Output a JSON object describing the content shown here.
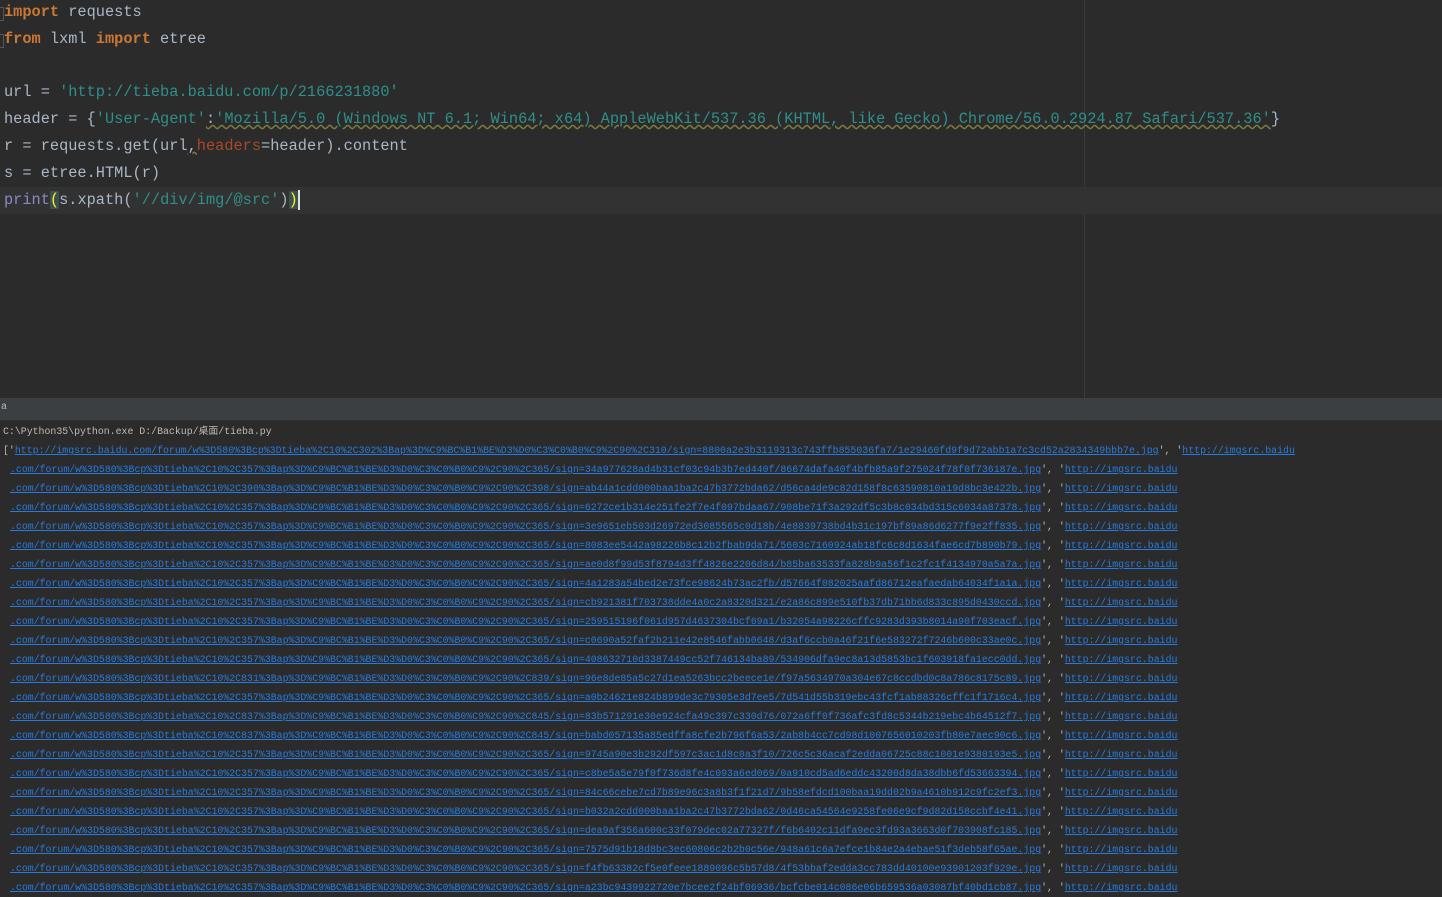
{
  "editor": {
    "lines": {
      "l1_kw": "import",
      "l1_rest": " requests",
      "l2_kw1": "from",
      "l2_mid": " lxml ",
      "l2_kw2": "import",
      "l2_rest": " etree",
      "l4_a": "url = ",
      "l4_str": "'http://tieba.baidu.com/p/2166231880'",
      "l5_a": "header = {",
      "l5_key": "'User-Agent'",
      "l5_colon": ":",
      "l5_val": "'Mozilla/5.0 (Windows NT 6.1; Win64; x64) AppleWebKit/537.36 (KHTML, like Gecko) Chrome/56.0.2924.87 Safari/537.36'",
      "l5_end": "}",
      "l6_a": "r = requests.get(url",
      "l6_comma": ",",
      "l6_param": "headers",
      "l6_rest": "=header).content",
      "l7": "s = etree.HTML(r)",
      "l8_fn": "print",
      "l8_open": "(",
      "l8_mid": "s.xpath(",
      "l8_str": "'//div/img/@src'",
      "l8_close1": ")",
      "l8_close2": ")"
    }
  },
  "run_panel": {
    "tab_label": "a",
    "command": "C:\\Python35\\python.exe D:/Backup/桌面/tieba.py",
    "first_line": {
      "prefix": "['",
      "link": "http://imgsrc.baidu.com/forum/w%3D580%3Bcp%3Dtieba%2C10%2C302%3Bap%3D%C9%BC%B1%BE%D3%D0%C3%C0%B0%C9%2C90%2C310/sign=8800a2e3b3119313c743ffb855036fa7/1e29460fd9f9d72abb1a7c3cd52a2834349bbb7e.jpg",
      "sep": "', '",
      "next": "http://imgsrc.baidu"
    },
    "rows": [
      ".com/forum/w%3D580%3Bcp%3Dtieba%2C10%2C357%3Bap%3D%C9%BC%B1%BE%D3%D0%C3%C0%B0%C9%2C90%2C365/sign=34a977628ad4b31cf03c94b3b7ed440f/86674dafa40f4bfb85a9f275024f78f0f736187e.jpg",
      ".com/forum/w%3D580%3Bcp%3Dtieba%2C10%2C390%3Bap%3D%C9%BC%B1%BE%D3%D0%C3%C0%B0%C9%2C90%2C398/sign=ab44a1cdd000baa1ba2c47b3772bda62/d56ca4de9c82d158f8c63590810a19d8bc3e422b.jpg",
      ".com/forum/w%3D580%3Bcp%3Dtieba%2C10%2C357%3Bap%3D%C9%BC%B1%BE%D3%D0%C3%C0%B0%C9%2C90%2C365/sign=6272ce1b314e251fe2f7e4f097bdaa67/908be71f3a292df5c3b8c034bd315c6034a87378.jpg",
      ".com/forum/w%3D580%3Bcp%3Dtieba%2C10%2C357%3Bap%3D%C9%BC%B1%BE%D3%D0%C3%C0%B0%C9%2C90%2C365/sign=3e9651eb503d26972ed3085565c0d18b/4e8839738bd4b31c197bf89a86d6277f9e2ff835.jpg",
      ".com/forum/w%3D580%3Bcp%3Dtieba%2C10%2C357%3Bap%3D%C9%BC%B1%BE%D3%D0%C3%C0%B0%C9%2C90%2C365/sign=8083ee5442a98226b8c12b2fbab9da71/5603c7160924ab18fc6c8d1634fae6cd7b890b79.jpg",
      ".com/forum/w%3D580%3Bcp%3Dtieba%2C10%2C357%3Bap%3D%C9%BC%B1%BE%D3%D0%C3%C0%B0%C9%2C90%2C365/sign=ae0d8f99d53f8794d3ff4826e2206d84/b85ba63533fa828b9a56f1c2fc1f4134970a5a7a.jpg",
      ".com/forum/w%3D580%3Bcp%3Dtieba%2C10%2C357%3Bap%3D%C9%BC%B1%BE%D3%D0%C3%C0%B0%C9%2C90%2C365/sign=4a1283a54bed2e73fce98624b73ac2fb/d57664f082025aafd86712eafaedab64034f1a1a.jpg",
      ".com/forum/w%3D580%3Bcp%3Dtieba%2C10%2C357%3Bap%3D%C9%BC%B1%BE%D3%D0%C3%C0%B0%C9%2C90%2C365/sign=cb921381f703738dde4a0c2a8320d321/e2a86c899e510fb37db71bb6d833c895d0430ccd.jpg",
      ".com/forum/w%3D580%3Bcp%3Dtieba%2C10%2C357%3Bap%3D%C9%BC%B1%BE%D3%D0%C3%C0%B0%C9%2C90%2C365/sign=259515196f061d957d4637304bcf69a1/b32054a98226cffc9283d393b8014a90f703eacf.jpg",
      ".com/forum/w%3D580%3Bcp%3Dtieba%2C10%2C357%3Bap%3D%C9%BC%B1%BE%D3%D0%C3%C0%B0%C9%2C90%2C365/sign=c0690a52faf2b211e42e8546fabb0648/d3af6ccb0a46f21f6e583272f7246b600c33ae0c.jpg",
      ".com/forum/w%3D580%3Bcp%3Dtieba%2C10%2C357%3Bap%3D%C9%BC%B1%BE%D3%D0%C3%C0%B0%C9%2C90%2C365/sign=408632710d3387449cc52f746134ba89/534906dfa9ec8a13d5853bc1f603918fa1ecc0dd.jpg",
      ".com/forum/w%3D580%3Bcp%3Dtieba%2C10%2C831%3Bap%3D%C9%BC%B1%BE%D3%D0%C3%C0%B0%C9%2C90%2C839/sign=96e8de85a5c27d1ea5263bcc2beece1e/f97a5634970a304e67c8ccdbd0c8a786c8175c89.jpg",
      ".com/forum/w%3D580%3Bcp%3Dtieba%2C10%2C357%3Bap%3D%C9%BC%B1%BE%D3%D0%C3%C0%B0%C9%2C90%2C365/sign=a0b24621e824b899de3c79305e3d7ee5/7d541d55b319ebc43fcf1ab88326cffc1f1716c4.jpg",
      ".com/forum/w%3D580%3Bcp%3Dtieba%2C10%2C837%3Bap%3D%C9%BC%B1%BE%D3%D0%C3%C0%B0%C9%2C90%2C845/sign=83b571291e30e924cfa49c397c330d76/072a6ff0f736afc3fd8c5344b219ebc4b64512f7.jpg",
      ".com/forum/w%3D580%3Bcp%3Dtieba%2C10%2C837%3Bap%3D%C9%BC%B1%BE%D3%D0%C3%C0%B0%C9%2C90%2C845/sign=babd057135a85edffa8cfe2b796f6a53/2ab8b4cc7cd98d1007656010203fb80e7aec90c6.jpg",
      ".com/forum/w%3D580%3Bcp%3Dtieba%2C10%2C357%3Bap%3D%C9%BC%B1%BE%D3%D0%C3%C0%B0%C9%2C90%2C365/sign=9745a90e3b292df597c3ac1d8c0a3f10/726c5c36acaf2edda06725c88c1001e9380193e5.jpg",
      ".com/forum/w%3D580%3Bcp%3Dtieba%2C10%2C357%3Bap%3D%C9%BC%B1%BE%D3%D0%C3%C0%B0%C9%2C90%2C365/sign=c8be5a5e79f0f736d8fe4c093a6ed069/0a910cd5ad6eddc43200d8da38dbb6fd53663394.jpg",
      ".com/forum/w%3D580%3Bcp%3Dtieba%2C10%2C357%3Bap%3D%C9%BC%B1%BE%D3%D0%C3%C0%B0%C9%2C90%2C365/sign=84c66cebe7cd7b89e96c3a8b3f1f21d7/9b58efdcd100baa19dd02b9a4610b912c9fc2ef3.jpg",
      ".com/forum/w%3D580%3Bcp%3Dtieba%2C10%2C357%3Bap%3D%C9%BC%B1%BE%D3%D0%C3%C0%B0%C9%2C90%2C365/sign=b032a2cdd000baa1ba2c47b3772bda62/0d46ca54564e9258fe06e9cf9d82d158ccbf4e41.jpg",
      ".com/forum/w%3D580%3Bcp%3Dtieba%2C10%2C357%3Bap%3D%C9%BC%B1%BE%D3%D0%C3%C0%B0%C9%2C90%2C365/sign=dea9af356a600c33f079dec02a77327f/f6b6402c11dfa9ec3fd93a3663d0f703908fc185.jpg",
      ".com/forum/w%3D580%3Bcp%3Dtieba%2C10%2C357%3Bap%3D%C9%BC%B1%BE%D3%D0%C3%C0%B0%C9%2C90%2C365/sign=7575d91b18d8bc3ec60806c2b2b0c56e/948a61c6a7efce1b84e2a4ebae51f3deb58f65ae.jpg",
      ".com/forum/w%3D580%3Bcp%3Dtieba%2C10%2C357%3Bap%3D%C9%BC%B1%BE%D3%D0%C3%C0%B0%C9%2C90%2C365/sign=f4fb63382cf5e0feee1889096c5b57d8/4f53bbaf2edda3cc783dd40100e93901203f929e.jpg",
      ".com/forum/w%3D580%3Bcp%3Dtieba%2C10%2C357%3Bap%3D%C9%BC%B1%BE%D3%D0%C3%C0%B0%C9%2C90%2C365/sign=a23bc9439922720e7bcee2f24bf06936/bcfcbe014c086e06b659536a03087bf40bd1cb87.jpg"
    ],
    "row_sep": "', '",
    "row_next": "http://imgsrc.baidu"
  },
  "colors": {
    "keyword": "#cc7832",
    "string": "#2f8f8a",
    "link": "#287bde",
    "background": "#2b2b2b"
  }
}
